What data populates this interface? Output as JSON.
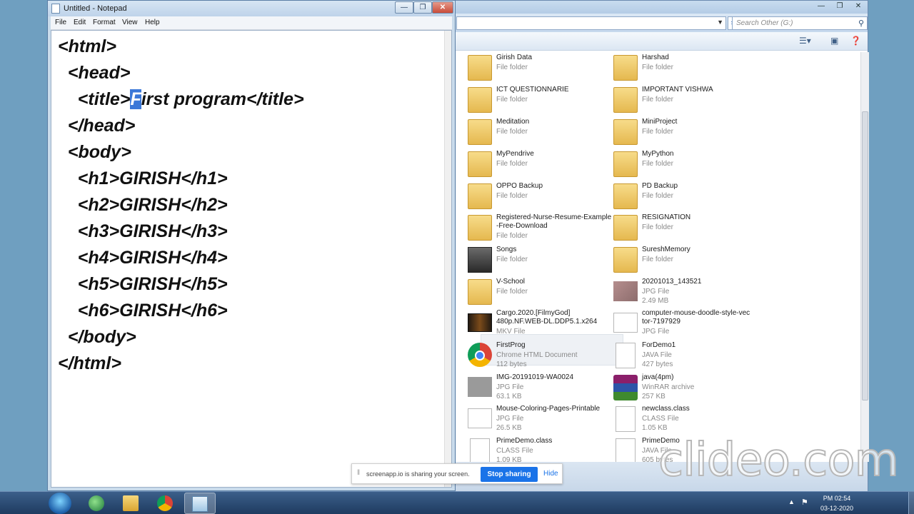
{
  "notepad": {
    "title": "Untitled - Notepad",
    "menu": [
      "File",
      "Edit",
      "Format",
      "View",
      "Help"
    ],
    "lines": [
      "<html>",
      "  <head>",
      "    <title>First program</title>",
      "  </head>",
      "  <body>",
      "    <h1>GIRISH</h1>",
      "    <h2>GIRISH</h2>",
      "    <h3>GIRISH</h3>",
      "    <h4>GIRISH</h4>",
      "    <h5>GIRISH</h5>",
      "    <h6>GIRISH</h6>",
      "  </body>",
      "</html>"
    ],
    "selected_char": "F"
  },
  "explorer": {
    "search_placeholder": "Search Other (G:)",
    "items": [
      {
        "name": "Girish Data",
        "type": "File folder",
        "icon": "folder-icon"
      },
      {
        "name": "Harshad",
        "type": "File folder",
        "icon": "folder-icon"
      },
      {
        "name": "ICT QUESTIONNARIE",
        "type": "File folder",
        "icon": "folder-icon"
      },
      {
        "name": "IMPORTANT VISHWA",
        "type": "File folder",
        "icon": "folder-icon"
      },
      {
        "name": "Meditation",
        "type": "File folder",
        "icon": "folder-icon"
      },
      {
        "name": "MiniProject",
        "type": "File folder",
        "icon": "folder-icon"
      },
      {
        "name": "MyPendrive",
        "type": "File folder",
        "icon": "folder-icon"
      },
      {
        "name": "MyPython",
        "type": "File folder",
        "icon": "folder-icon"
      },
      {
        "name": "OPPO Backup",
        "type": "File folder",
        "icon": "folder-icon"
      },
      {
        "name": "PD Backup",
        "type": "File folder",
        "icon": "folder-icon"
      },
      {
        "name": "Registered-Nurse-Resume-Example\n-Free-Download",
        "type": "File folder",
        "icon": "folder-icon"
      },
      {
        "name": "RESIGNATION",
        "type": "File folder",
        "icon": "folder-icon"
      },
      {
        "name": "Songs",
        "type": "File folder",
        "icon": "folder-icon"
      },
      {
        "name": "SureshMemory",
        "type": "File folder",
        "icon": "folder-icon"
      },
      {
        "name": "V-School",
        "type": "File folder",
        "icon": "folder-icon"
      },
      {
        "name": "20201013_143521",
        "type": "JPG File",
        "size": "2.49 MB",
        "icon": "image-icon"
      },
      {
        "name": "Cargo.2020.[FilmyGod]\n480p.NF.WEB-DL.DDP5.1.x264",
        "type": "MKV File",
        "icon": "video-icon"
      },
      {
        "name": "computer-mouse-doodle-style-vec\ntor-7197929",
        "type": "JPG File",
        "icon": "image-icon"
      },
      {
        "name": "FirstProg",
        "type": "Chrome HTML Document",
        "size": "112 bytes",
        "icon": "chrome-icon"
      },
      {
        "name": "ForDemo1",
        "type": "JAVA File",
        "size": "427 bytes",
        "icon": "file-icon"
      },
      {
        "name": "IMG-20191019-WA0024",
        "type": "JPG File",
        "size": "63.1 KB",
        "icon": "image-icon"
      },
      {
        "name": "java(4pm)",
        "type": "WinRAR archive",
        "size": "257 KB",
        "icon": "winrar-icon"
      },
      {
        "name": "Mouse-Coloring-Pages-Printable",
        "type": "JPG File",
        "size": "26.5 KB",
        "icon": "image-icon"
      },
      {
        "name": "newclass.class",
        "type": "CLASS File",
        "size": "1.05 KB",
        "icon": "file-icon"
      },
      {
        "name": "PrimeDemo.class",
        "type": "CLASS File",
        "size": "1.09 KB",
        "icon": "file-icon"
      },
      {
        "name": "PrimeDemo",
        "type": "JAVA File",
        "size": "605 bytes",
        "icon": "file-icon"
      }
    ]
  },
  "sharebar": {
    "message": "screenapp.io is sharing your screen.",
    "stop_label": "Stop sharing",
    "hide_label": "Hide"
  },
  "watermark": "clideo.com",
  "taskbar": {
    "time": "PM 02:54",
    "date": "03-12-2020"
  }
}
